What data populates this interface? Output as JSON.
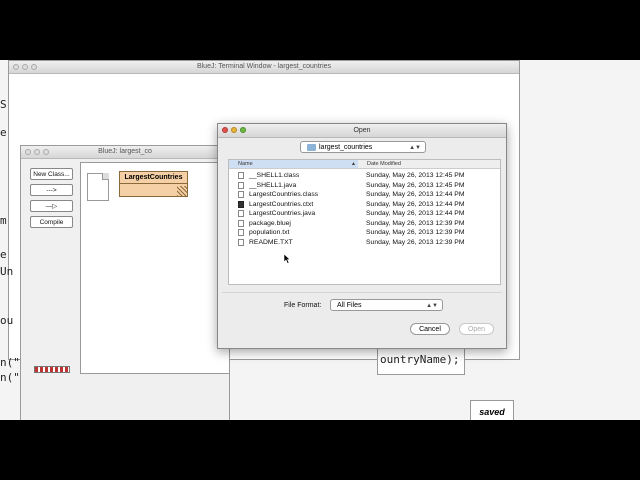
{
  "terminal": {
    "title": "BlueJ: Terminal Window - largest_countries",
    "code_right": "ountryName);",
    "saved": "saved",
    "frag_left": [
      "S",
      "e",
      "m",
      "e",
      "Un",
      "ou",
      "n(\"",
      "n(\""
    ]
  },
  "project": {
    "title": "BlueJ:  largest_co",
    "buttons": {
      "new_class": "New Class...",
      "arrow1": "--->",
      "arrow2": "—▷",
      "compile": "Compile"
    },
    "class_name": "LargestCountries"
  },
  "dialog": {
    "title": "Open",
    "folder": "largest_countries",
    "columns": {
      "name": "Name",
      "date": "Date Modified"
    },
    "files": [
      {
        "name": "__SHELL1.class",
        "date": "Sunday, May 26, 2013 12:45 PM",
        "icon": "class-file-icon"
      },
      {
        "name": "__SHELL1.java",
        "date": "Sunday, May 26, 2013 12:45 PM",
        "icon": "java-file-icon"
      },
      {
        "name": "LargestCountries.class",
        "date": "Sunday, May 26, 2013 12:44 PM",
        "icon": "class-file-icon"
      },
      {
        "name": "LargestCountries.ctxt",
        "date": "Sunday, May 26, 2013 12:44 PM",
        "icon": "ctxt-file-icon"
      },
      {
        "name": "LargestCountries.java",
        "date": "Sunday, May 26, 2013 12:44 PM",
        "icon": "java-file-icon"
      },
      {
        "name": "package.bluej",
        "date": "Sunday, May 26, 2013 12:39 PM",
        "icon": "bluej-file-icon"
      },
      {
        "name": "population.txt",
        "date": "Sunday, May 26, 2013 12:39 PM",
        "icon": "text-file-icon"
      },
      {
        "name": "README.TXT",
        "date": "Sunday, May 26, 2013 12:39 PM",
        "icon": "text-file-icon"
      }
    ],
    "file_format_label": "File Format:",
    "file_format_value": "All Files",
    "cancel": "Cancel",
    "open": "Open"
  }
}
